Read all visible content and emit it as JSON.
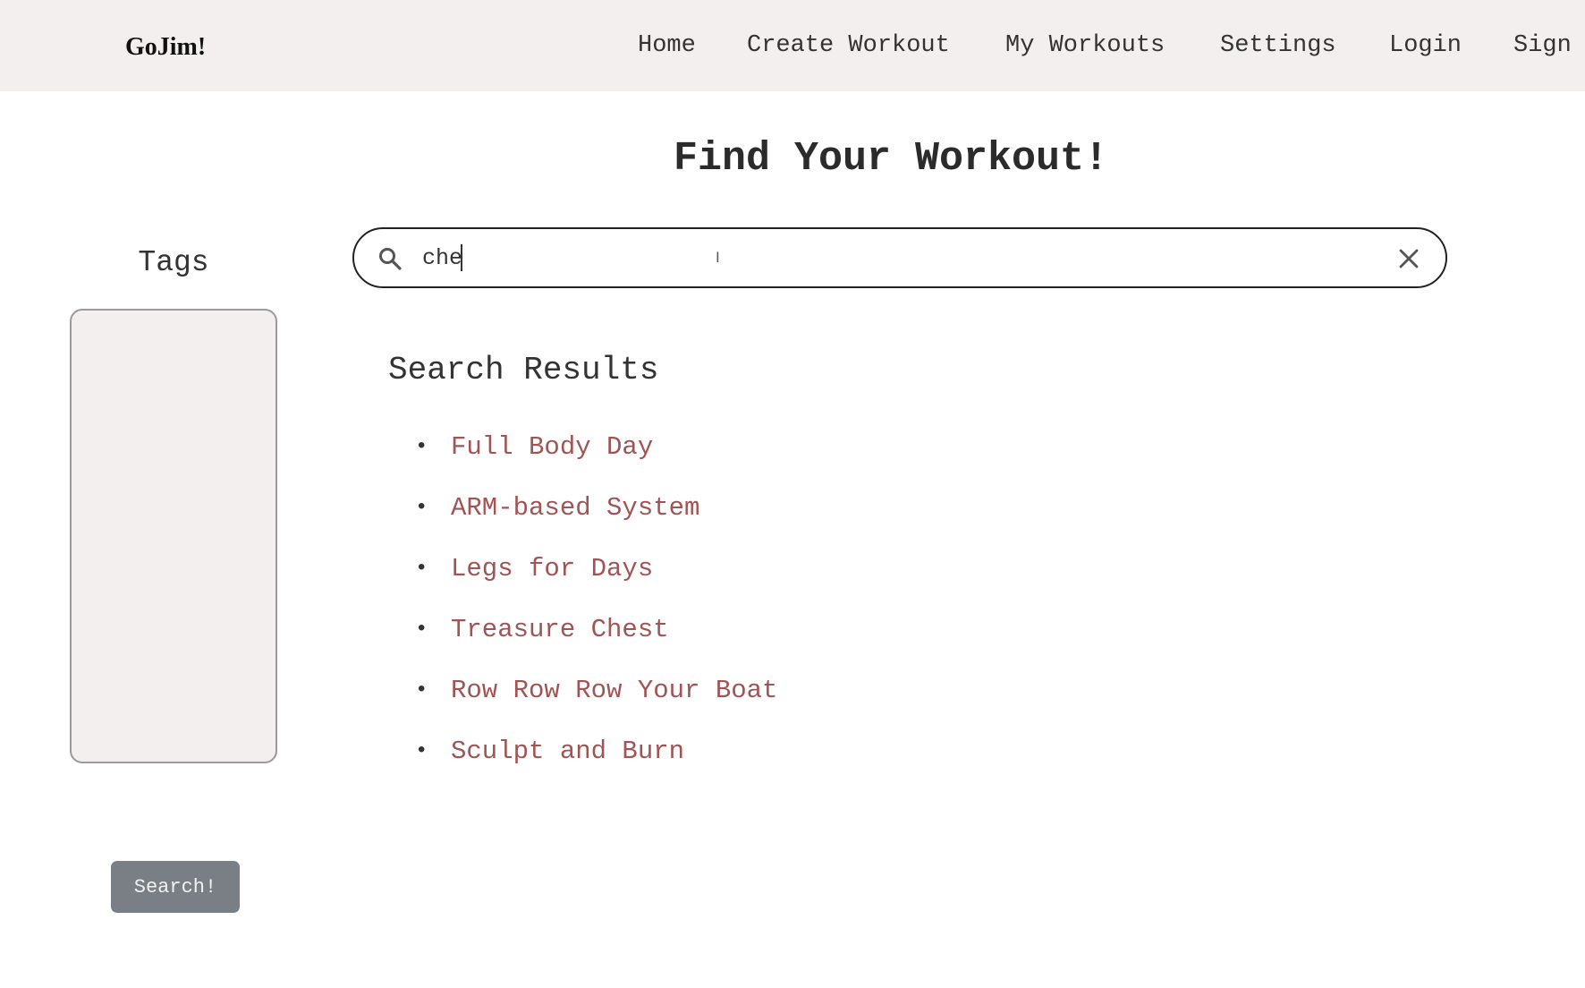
{
  "navbar": {
    "brand": "GoJim!",
    "links": [
      "Home",
      "Create Workout",
      "My Workouts",
      "Settings",
      "Login",
      "Sign"
    ]
  },
  "page_title": "Find Your Workout!",
  "search": {
    "value": "che",
    "placeholder": ""
  },
  "sidebar": {
    "tags_title": "Tags",
    "tags": [],
    "search_button": "Search!"
  },
  "results": {
    "title": "Search Results",
    "items": [
      "Full Body Day",
      "ARM-based System",
      "Legs for Days",
      "Treasure Chest",
      "Row Row Row Your Boat",
      "Sculpt and Burn"
    ]
  },
  "colors": {
    "navbar_bg": "#f4efef",
    "link_color": "#a05454",
    "button_bg": "#7a7f86"
  }
}
